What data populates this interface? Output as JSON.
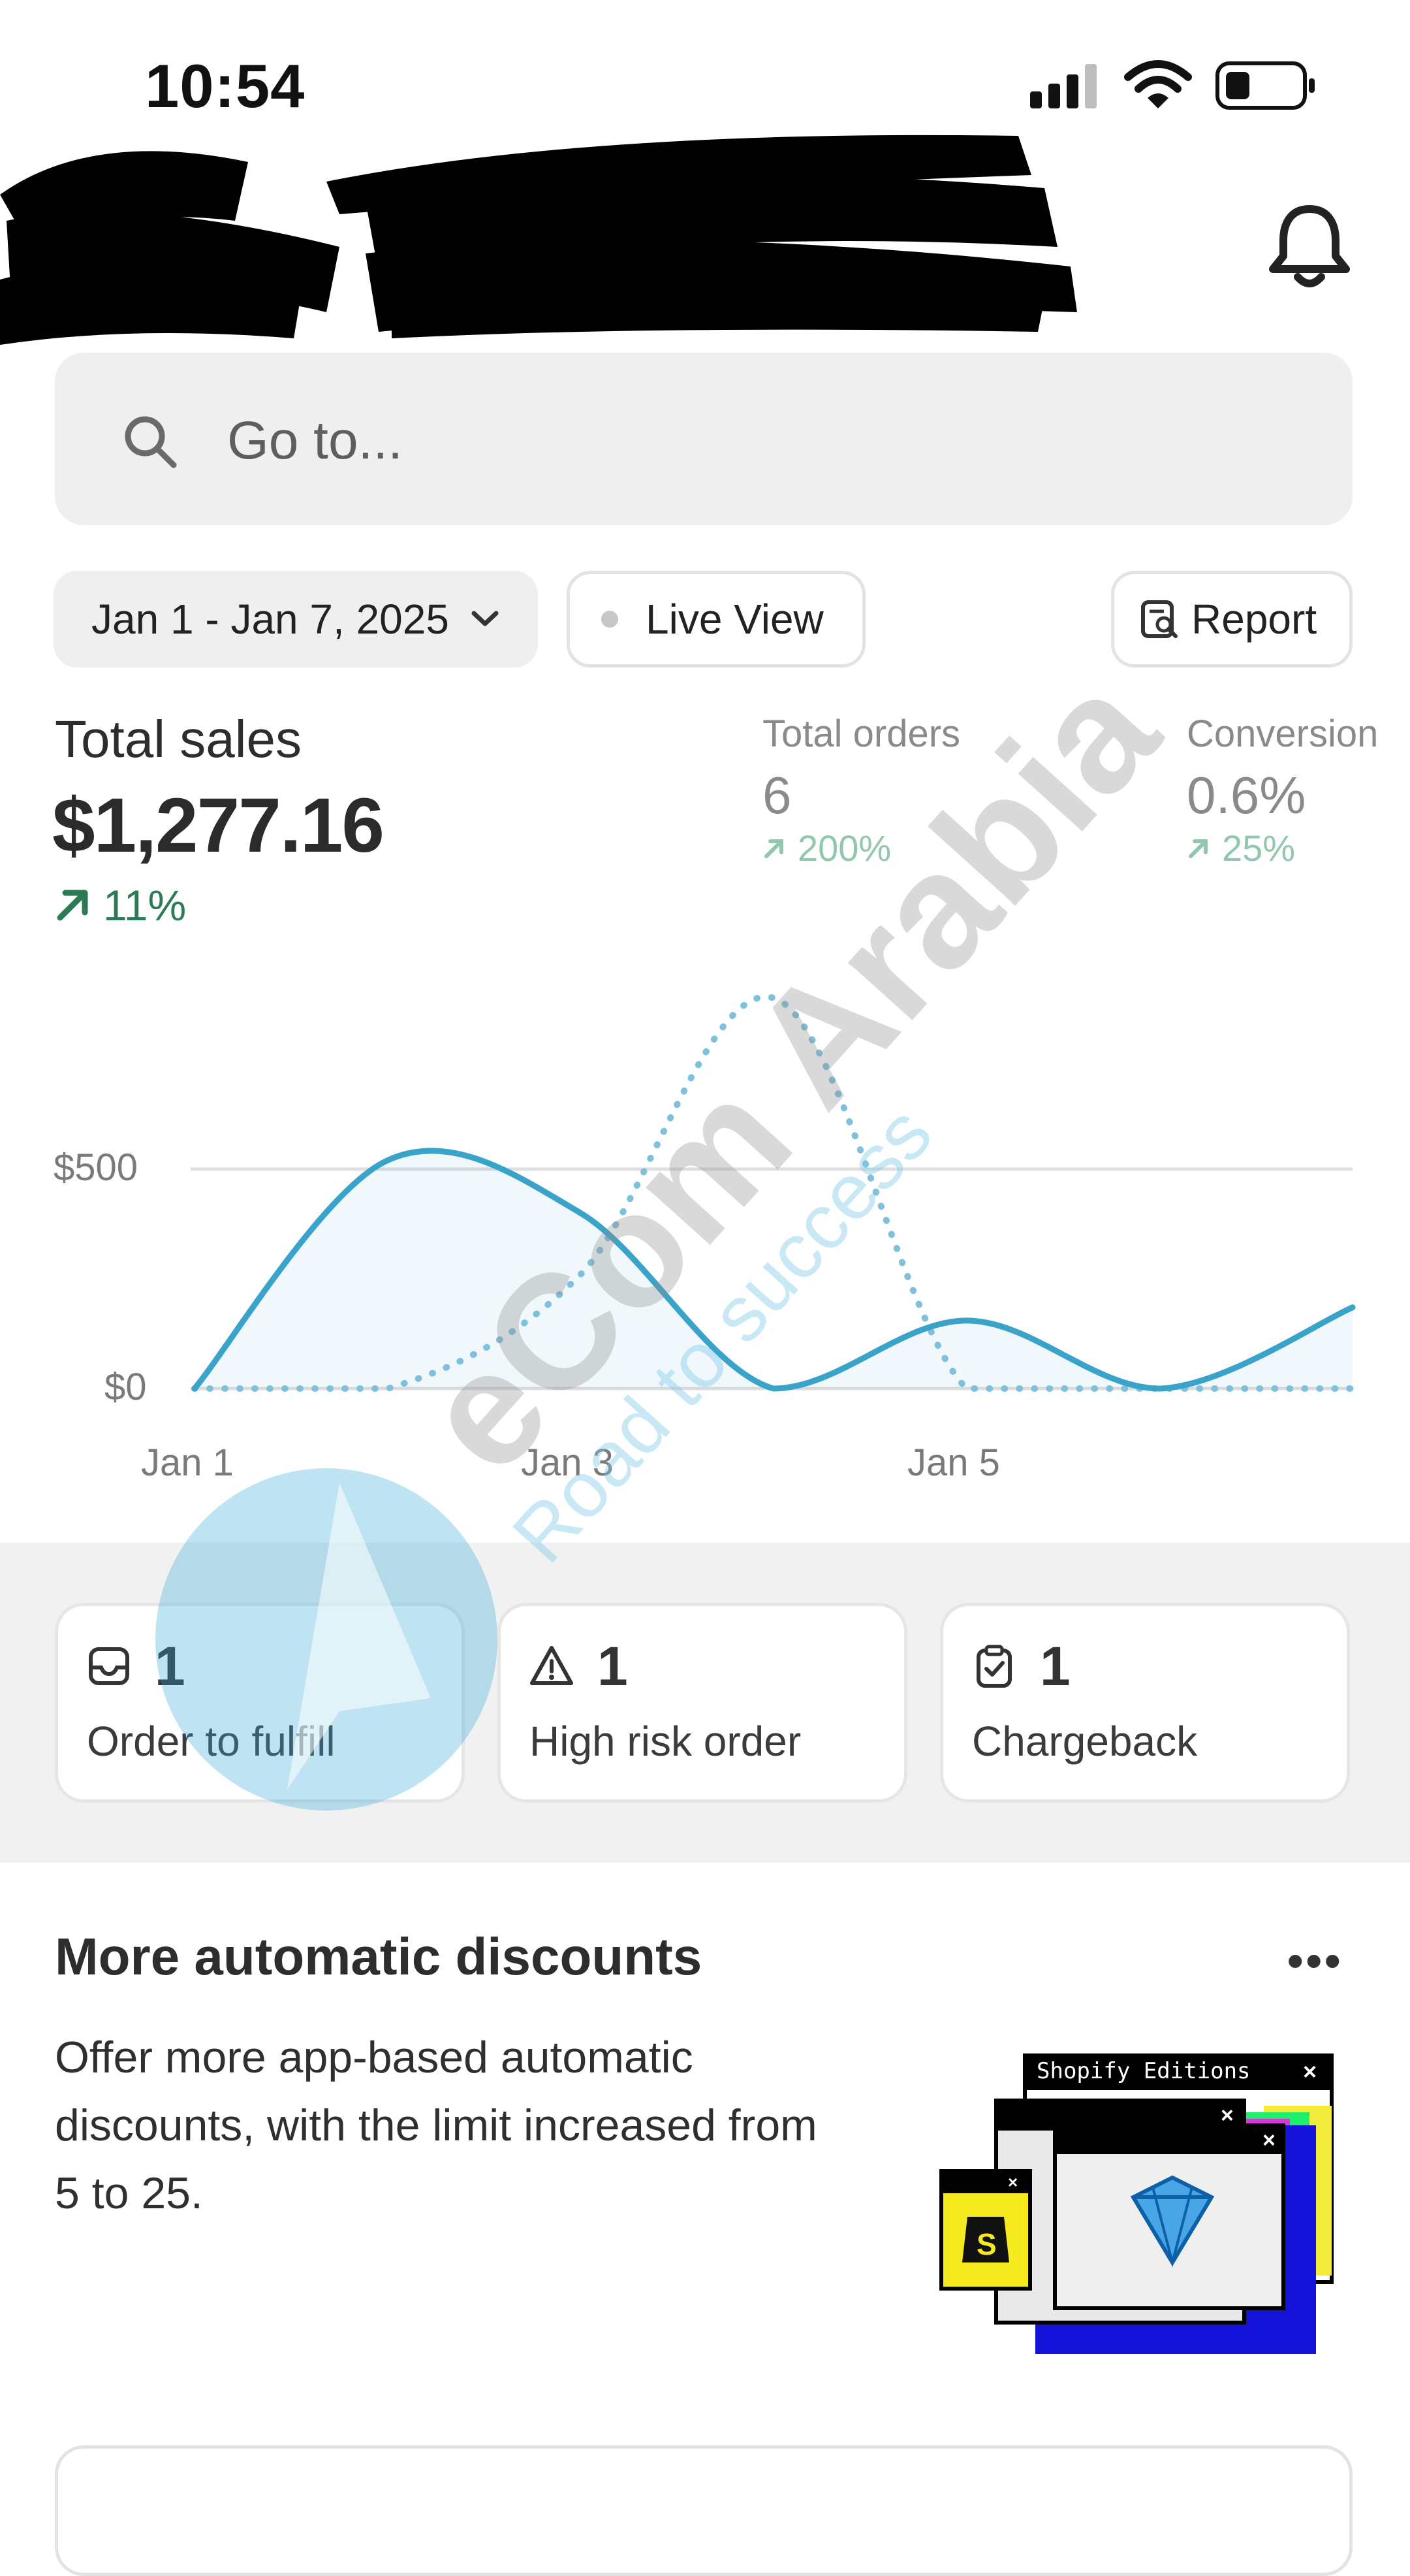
{
  "status_bar": {
    "time": "10:54",
    "signal_icon": "cellular-signal-icon",
    "wifi_icon": "wifi-icon",
    "battery_icon": "battery-low-icon"
  },
  "header": {
    "store_name": "",
    "notifications_icon": "bell-icon"
  },
  "search": {
    "placeholder": "Go to...",
    "icon": "search-icon"
  },
  "filters": {
    "date_range": "Jan 1 - Jan 7, 2025",
    "live_view": "Live View",
    "report": "Report"
  },
  "metrics": {
    "total_sales": {
      "label": "Total sales",
      "value": "$1,277.16",
      "change": "11%"
    },
    "total_orders": {
      "label": "Total orders",
      "value": "6",
      "change": "200%"
    },
    "conversion": {
      "label": "Conversion",
      "value": "0.6%",
      "change": "25%"
    }
  },
  "chart_data": {
    "type": "line",
    "x": [
      "Jan 1",
      "Jan 2",
      "Jan 3",
      "Jan 4",
      "Jan 5",
      "Jan 6",
      "Jan 7"
    ],
    "x_tick_labels": [
      "Jan 1",
      "Jan 3",
      "Jan 5"
    ],
    "y_tick_labels": [
      "$0",
      "$500"
    ],
    "ylim": [
      0,
      800
    ],
    "grid": true,
    "series": [
      {
        "style": "solid",
        "color": "#3aa3c9",
        "values": [
          0,
          520,
          400,
          0,
          155,
          0,
          185
        ]
      },
      {
        "style": "dotted",
        "color": "#7fc0dc",
        "values": [
          0,
          0,
          260,
          890,
          0,
          0,
          0
        ]
      }
    ]
  },
  "alerts": [
    {
      "icon": "inbox-icon",
      "count": "1",
      "label": "Order to fulfill"
    },
    {
      "icon": "warning-triangle-icon",
      "count": "1",
      "label": "High risk order"
    },
    {
      "icon": "clipboard-check-icon",
      "count": "1",
      "label": "Chargeback"
    }
  ],
  "promo": {
    "title": "More automatic discounts",
    "body": "Offer more app-based automatic discounts, with the limit increased from 5 to 25.",
    "menu_label": "•••",
    "art_window_title": "Shopify Editions"
  },
  "watermark": {
    "brand": "eCom Arabia",
    "tagline": "Road to success"
  },
  "colors": {
    "positive": "#2c7a56",
    "positive_muted": "#93c7ad",
    "chart_line": "#3aa3c9",
    "card_border": "#e6e6e6"
  }
}
